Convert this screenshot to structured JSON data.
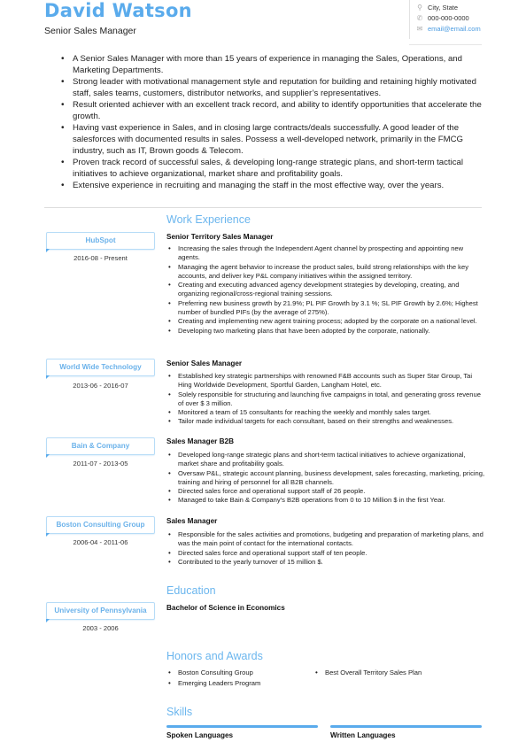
{
  "header": {
    "name": "David Watson",
    "title": "Senior Sales Manager",
    "contact": {
      "location": "City, State",
      "phone": "000-000-0000",
      "email": "email@email.com",
      "icons": [
        "map-pin-icon",
        "phone-icon",
        "envelope-icon"
      ]
    }
  },
  "summary": [
    "A Senior Sales Manager with more than 15 years of experience in managing the Sales, Operations, and Marketing Departments.",
    "Strong leader with motivational management style and reputation for building and retaining highly motivated staff, sales teams, customers, distributor networks, and supplier’s representatives.",
    "Result oriented achiever with an excellent track record, and ability to identify opportunities that accelerate the growth.",
    "Having vast experience in Sales, and in closing large contracts/deals successfully. A good leader of the salesforces with documented results in sales. Possess a well-developed network, primarily in the FMCG industry, such as IT, Brown goods & Telecom.",
    "Proven track record of successful sales, & developing long-range strategic plans, and short-term tactical initiatives to achieve organizational, market share and profitability goals.",
    "Extensive experience in recruiting and managing the staff in the most effective way, over the years."
  ],
  "work": {
    "heading": "Work Experience",
    "jobs": [
      {
        "company": "HubSpot",
        "dates": "2016-08 - Present",
        "role": "Senior Territory Sales Manager",
        "bullets": [
          "Increasing the sales through the Independent Agent channel by prospecting and appointing new agents.",
          "Managing the agent behavior to increase the product sales, build strong relationships with the key accounts, and deliver key P&L company initiatives within the assigned territory.",
          "Creating and executing advanced agency development strategies by developing, creating, and organizing regional/cross-regional training sessions.",
          "Preferring new business growth by 21.9%; PL PIF Growth by 3.1 %; SL PIF Growth by 2.6%; Highest number of bundled PIFs (by the average of 275%).",
          "Creating and implementing new agent training process; adopted by the corporate on a national level.",
          "Developing two marketing plans that have been adopted by the corporate, nationally."
        ]
      },
      {
        "company": "World Wide Technology",
        "dates": "2013-06 - 2016-07",
        "role": "Senior Sales Manager",
        "bullets": [
          "Established key strategic partnerships with renowned F&B accounts such as Super Star Group, Tai Hing Worldwide Development, Sportful Garden, Langham Hotel, etc.",
          "Solely responsible for structuring and launching five campaigns in total, and generating gross revenue of over $ 3 million.",
          "Monitored a team of 15 consultants for reaching the weekly and monthly sales target.",
          "Tailor made individual targets for each consultant, based on their strengths and weaknesses."
        ]
      },
      {
        "company": "Bain & Company",
        "dates": "2011-07 - 2013-05",
        "role": "Sales Manager B2B",
        "bullets": [
          "Developed long-range strategic plans and short-term tactical initiatives to achieve organizational, market share and profitability goals.",
          "Oversaw P&L, strategic account planning, business development, sales forecasting, marketing, pricing, training and hiring of personnel for all B2B channels.",
          "Directed sales force and operational support staff of 26 people.",
          "Managed to take Bain & Company's B2B operations from 0 to 10 Million $ in the first Year."
        ]
      },
      {
        "company": "Boston Consulting Group",
        "dates": "2006-04 - 2011-06",
        "role": "Sales Manager",
        "bullets": [
          "Responsible for the sales activities and promotions, budgeting and preparation of marketing plans, and was the main point of contact for the international contacts.",
          "Directed sales force and operational support staff of ten people.",
          "Contributed to the yearly turnover of 15 million $."
        ]
      }
    ]
  },
  "education": {
    "heading": "Education",
    "school": "University of Pennsylvania",
    "dates": "2003 - 2006",
    "degree": "Bachelor of Science in Economics"
  },
  "honors": {
    "heading": "Honors and Awards",
    "col1": [
      "Boston Consulting Group",
      "Emerging Leaders Program"
    ],
    "col2": [
      "Best Overall Territory Sales Plan"
    ]
  },
  "skills": {
    "heading": "Skills",
    "groups": [
      "Spoken Languages",
      "Written Languages"
    ]
  },
  "colors": {
    "accent": "#5aabec",
    "text": "#222222"
  }
}
